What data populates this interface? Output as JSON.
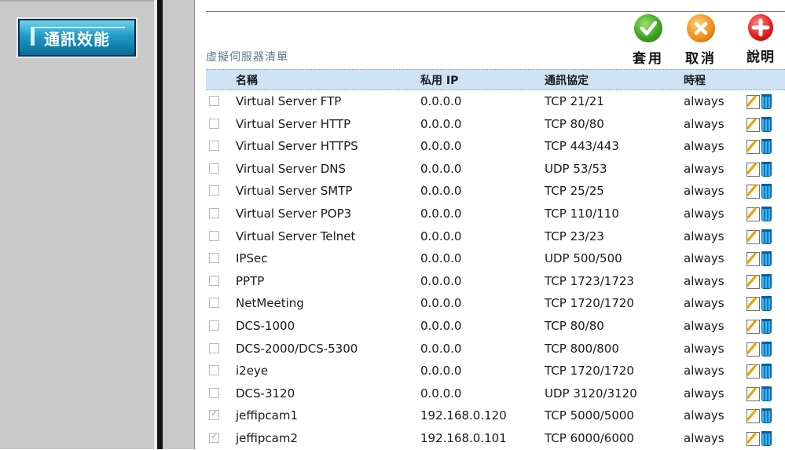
{
  "sidebar": {
    "nav_button": "通訊效能"
  },
  "section_title": "虛擬伺服器清單",
  "toolbar": {
    "apply_label": "套用",
    "cancel_label": "取消",
    "help_label": "說明"
  },
  "table": {
    "columns": [
      "名稱",
      "私用 IP",
      "通訊協定",
      "時程"
    ],
    "rows": [
      {
        "checked": false,
        "name": "Virtual Server FTP",
        "ip": "0.0.0.0",
        "protocol": "TCP 21/21",
        "schedule": "always"
      },
      {
        "checked": false,
        "name": "Virtual Server HTTP",
        "ip": "0.0.0.0",
        "protocol": "TCP 80/80",
        "schedule": "always"
      },
      {
        "checked": false,
        "name": "Virtual Server HTTPS",
        "ip": "0.0.0.0",
        "protocol": "TCP 443/443",
        "schedule": "always"
      },
      {
        "checked": false,
        "name": "Virtual Server DNS",
        "ip": "0.0.0.0",
        "protocol": "UDP 53/53",
        "schedule": "always"
      },
      {
        "checked": false,
        "name": "Virtual Server SMTP",
        "ip": "0.0.0.0",
        "protocol": "TCP 25/25",
        "schedule": "always"
      },
      {
        "checked": false,
        "name": "Virtual Server POP3",
        "ip": "0.0.0.0",
        "protocol": "TCP 110/110",
        "schedule": "always"
      },
      {
        "checked": false,
        "name": "Virtual Server Telnet",
        "ip": "0.0.0.0",
        "protocol": "TCP 23/23",
        "schedule": "always"
      },
      {
        "checked": false,
        "name": "IPSec",
        "ip": "0.0.0.0",
        "protocol": "UDP 500/500",
        "schedule": "always"
      },
      {
        "checked": false,
        "name": "PPTP",
        "ip": "0.0.0.0",
        "protocol": "TCP 1723/1723",
        "schedule": "always"
      },
      {
        "checked": false,
        "name": "NetMeeting",
        "ip": "0.0.0.0",
        "protocol": "TCP 1720/1720",
        "schedule": "always"
      },
      {
        "checked": false,
        "name": "DCS-1000",
        "ip": "0.0.0.0",
        "protocol": "TCP 80/80",
        "schedule": "always"
      },
      {
        "checked": false,
        "name": "DCS-2000/DCS-5300",
        "ip": "0.0.0.0",
        "protocol": "TCP 800/800",
        "schedule": "always"
      },
      {
        "checked": false,
        "name": "i2eye",
        "ip": "0.0.0.0",
        "protocol": "TCP 1720/1720",
        "schedule": "always"
      },
      {
        "checked": false,
        "name": "DCS-3120",
        "ip": "0.0.0.0",
        "protocol": "UDP 3120/3120",
        "schedule": "always"
      },
      {
        "checked": true,
        "name": "jeffipcam1",
        "ip": "192.168.0.120",
        "protocol": "TCP 5000/5000",
        "schedule": "always"
      },
      {
        "checked": true,
        "name": "jeffipcam2",
        "ip": "192.168.0.101",
        "protocol": "TCP 6000/6000",
        "schedule": "always"
      }
    ]
  },
  "icons": {
    "apply": "check-circle-icon",
    "cancel": "x-circle-icon",
    "help": "plus-circle-icon",
    "row_edit": "edit-icon",
    "row_delete": "trash-icon"
  },
  "colors": {
    "nav_button": "#1f9ac4",
    "header_row": "#cfe3f6",
    "section_title": "#5b8088"
  }
}
